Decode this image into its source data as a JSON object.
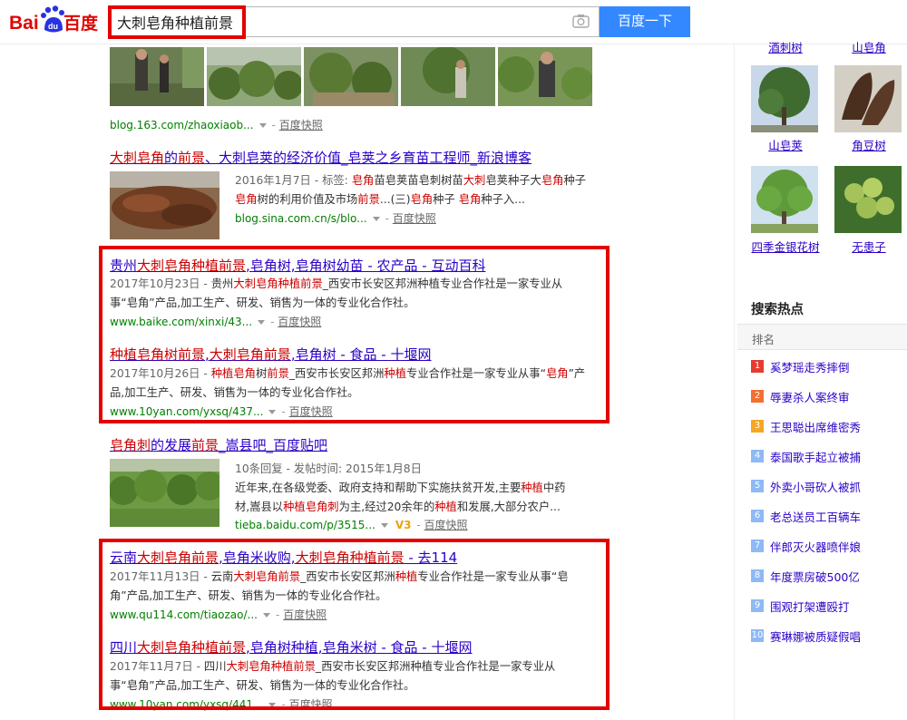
{
  "header": {
    "logo_text": [
      "Bai",
      "du",
      "百度"
    ],
    "search_value": "大刺皂角种植前景",
    "search_button": "百度一下",
    "camera_icon": "camera-icon"
  },
  "results": [
    {
      "id": "r0",
      "url": "blog.163.com/zhaoxiaob...",
      "snapshot": "百度快照"
    },
    {
      "id": "r1",
      "title": [
        [
          "大刺皂角",
          "hl"
        ],
        [
          "的",
          ""
        ],
        [
          "前景",
          "hl"
        ],
        [
          "、大刺皂荚的经济价值_皂荚之乡育苗工程师_新浪博客",
          ""
        ]
      ],
      "snippet_lines": [
        [
          [
            "2016年1月7日 - 标签: ",
            "date"
          ],
          [
            "皂角",
            "hl"
          ],
          [
            "苗皂荚苗皂刺树苗",
            ""
          ],
          [
            "大刺",
            "hl"
          ],
          [
            "皂荚种子大",
            ""
          ],
          [
            "皂角",
            "hl"
          ],
          [
            "种子",
            ""
          ]
        ],
        [
          [
            "皂角",
            "hl"
          ],
          [
            "树的利用价值及市场",
            ""
          ],
          [
            "前景",
            "hl"
          ],
          [
            "...(三)",
            ""
          ],
          [
            "皂角",
            "hl"
          ],
          [
            "种子 ",
            ""
          ],
          [
            "皂角",
            "hl"
          ],
          [
            "种子入...",
            ""
          ]
        ]
      ],
      "url": "blog.sina.com.cn/s/blo...",
      "snapshot": "百度快照"
    },
    {
      "id": "r2",
      "title": [
        [
          "贵州",
          ""
        ],
        [
          "大刺皂角种植前景",
          "hl"
        ],
        [
          ",皂角树,皂角树幼苗 - 农产品 - 互动百科",
          ""
        ]
      ],
      "snippet_lines": [
        [
          [
            "2017年10月23日 - ",
            "date"
          ],
          [
            "贵州",
            ""
          ],
          [
            "大刺皂角种植前景",
            "hl"
          ],
          [
            "_西安市长安区邦洲种植专业合作社是一家专业从",
            ""
          ]
        ],
        [
          [
            "事“皂角”产品,加工生产、研发、销售为一体的专业化合作社。",
            ""
          ]
        ]
      ],
      "url": "www.baike.com/xinxi/43...",
      "snapshot": "百度快照"
    },
    {
      "id": "r3",
      "title": [
        [
          "种植皂角树前景",
          "hl"
        ],
        [
          ",",
          ""
        ],
        [
          "大刺皂角前景",
          "hl"
        ],
        [
          ",皂角树 - 食品 - 十堰网",
          ""
        ]
      ],
      "snippet_lines": [
        [
          [
            "2017年10月26日 - ",
            "date"
          ],
          [
            "种植皂角",
            "hl"
          ],
          [
            "树",
            ""
          ],
          [
            "前景",
            "hl"
          ],
          [
            "_西安市长安区邦洲",
            ""
          ],
          [
            "种植",
            "hl"
          ],
          [
            "专业合作社是一家专业从事“",
            ""
          ],
          [
            "皂角",
            "hl"
          ],
          [
            "”产",
            ""
          ]
        ],
        [
          [
            "品,加工生产、研发、销售为一体的专业化合作社。",
            ""
          ]
        ]
      ],
      "url": "www.10yan.com/yxsq/437...",
      "snapshot": "百度快照"
    },
    {
      "id": "r4",
      "title": [
        [
          "皂角刺",
          "hl"
        ],
        [
          "的发展",
          ""
        ],
        [
          "前景",
          "hl"
        ],
        [
          "_嵩县吧_百度贴吧",
          ""
        ]
      ],
      "snippet_lines": [
        [
          [
            "10条回复 - 发帖时间: 2015年1月8日",
            "date"
          ]
        ],
        [
          [
            "近年来,在各级党委、政府支持和帮助下实施扶贫开发,主要",
            ""
          ],
          [
            "种植",
            "hl"
          ],
          [
            "中药",
            ""
          ]
        ],
        [
          [
            "材,嵩县以",
            ""
          ],
          [
            "种植皂角刺",
            "hl"
          ],
          [
            "为主,经过20余年的",
            ""
          ],
          [
            "种植",
            "hl"
          ],
          [
            "和发展,大部分农户...",
            ""
          ]
        ]
      ],
      "url": "tieba.baidu.com/p/3515...",
      "badge": "V3",
      "snapshot": "百度快照"
    },
    {
      "id": "r5",
      "title": [
        [
          "云南",
          ""
        ],
        [
          "大刺皂角前景",
          "hl"
        ],
        [
          ",皂角米收购,",
          ""
        ],
        [
          "大刺皂角种植前景",
          "hl"
        ],
        [
          " - 去114",
          ""
        ]
      ],
      "snippet_lines": [
        [
          [
            "2017年11月13日 - ",
            "date"
          ],
          [
            "云南",
            ""
          ],
          [
            "大刺皂角前景",
            "hl"
          ],
          [
            "_西安市长安区邦洲",
            ""
          ],
          [
            "种植",
            "hl"
          ],
          [
            "专业合作社是一家专业从事“皂",
            ""
          ]
        ],
        [
          [
            "角”产品,加工生产、研发、销售为一体的专业化合作社。",
            ""
          ]
        ]
      ],
      "url": "www.qu114.com/tiaozao/...",
      "snapshot": "百度快照"
    },
    {
      "id": "r6",
      "title": [
        [
          "四川",
          ""
        ],
        [
          "大刺皂角种植前景",
          "hl"
        ],
        [
          ",皂角树种植,皂角米树 - 食品 - 十堰网",
          ""
        ]
      ],
      "snippet_lines": [
        [
          [
            "2017年11月7日 - ",
            "date"
          ],
          [
            "四川",
            ""
          ],
          [
            "大刺皂角种植前景",
            "hl"
          ],
          [
            "_西安市长安区邦洲种植专业合作社是一家专业从",
            ""
          ]
        ],
        [
          [
            "事“皂角”产品,加工生产、研发、销售为一体的专业化合作社。",
            ""
          ]
        ]
      ],
      "url": "www.10yan.com/yxsq/441...",
      "snapshot": "百度快照"
    }
  ],
  "sidebar": {
    "top_captions": [
      "酒刺树",
      "山皂角"
    ],
    "trees": [
      {
        "label": "山皂荚"
      },
      {
        "label": "角豆树"
      },
      {
        "label": "四季金银花树"
      },
      {
        "label": "无患子"
      }
    ],
    "hot_title": "搜索热点",
    "hot_header": "排名",
    "hot_items": [
      {
        "rank": "1",
        "text": "奚梦瑶走秀摔倒",
        "color": "#e43c31"
      },
      {
        "rank": "2",
        "text": "辱妻杀人案终审",
        "color": "#f46f31"
      },
      {
        "rank": "3",
        "text": "王思聪出席维密秀",
        "color": "#f5a623"
      },
      {
        "rank": "4",
        "text": "泰国歌手起立被捕",
        "color": "#8eb9f5"
      },
      {
        "rank": "5",
        "text": "外卖小哥砍人被抓",
        "color": "#8eb9f5"
      },
      {
        "rank": "6",
        "text": "老总送员工百辆车",
        "color": "#8eb9f5"
      },
      {
        "rank": "7",
        "text": "伴郎灭火器喷伴娘",
        "color": "#8eb9f5"
      },
      {
        "rank": "8",
        "text": "年度票房破500亿",
        "color": "#8eb9f5"
      },
      {
        "rank": "9",
        "text": "围观打架遭殴打",
        "color": "#8eb9f5"
      },
      {
        "rank": "10",
        "text": "赛琳娜被质疑假唱",
        "color": "#8eb9f5"
      }
    ]
  }
}
